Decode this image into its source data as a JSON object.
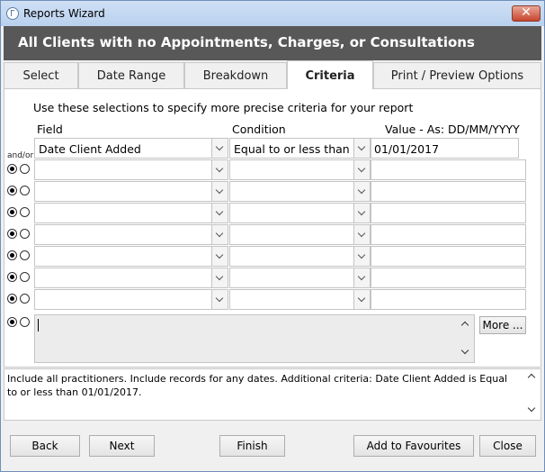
{
  "window": {
    "title": "Reports Wizard",
    "close_label": "✕"
  },
  "header": {
    "title": "All Clients with no Appointments, Charges, or Consultations"
  },
  "tabs": [
    {
      "label": "Select"
    },
    {
      "label": "Date Range"
    },
    {
      "label": "Breakdown"
    },
    {
      "label": "Criteria",
      "active": true
    },
    {
      "label": "Print / Preview Options"
    }
  ],
  "criteria": {
    "instruction": "Use these selections to specify more precise criteria for your report",
    "col_field": "Field",
    "col_condition": "Condition",
    "col_value": "Value - As: DD/MM/YYYY",
    "andor_label": "and/or",
    "rows": [
      {
        "field": "Date Client Added",
        "condition": "Equal to or less than",
        "value": "01/01/2017"
      },
      {
        "field": "",
        "condition": "",
        "value": ""
      },
      {
        "field": "",
        "condition": "",
        "value": ""
      },
      {
        "field": "",
        "condition": "",
        "value": ""
      },
      {
        "field": "",
        "condition": "",
        "value": ""
      },
      {
        "field": "",
        "condition": "",
        "value": ""
      },
      {
        "field": "",
        "condition": "",
        "value": ""
      },
      {
        "field": "",
        "condition": "",
        "value": ""
      }
    ],
    "more_button": "More ..."
  },
  "summary": {
    "text": "Include all practitioners. Include records for any dates. Additional criteria: Date Client Added is Equal to or less than 01/01/2017."
  },
  "buttons": {
    "back": "Back",
    "next": "Next",
    "finish": "Finish",
    "add_favourites": "Add to Favourites",
    "close": "Close"
  }
}
